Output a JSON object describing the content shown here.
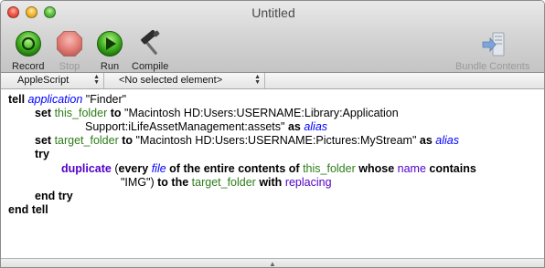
{
  "window": {
    "title": "Untitled"
  },
  "toolbar": {
    "record": "Record",
    "stop": "Stop",
    "run": "Run",
    "compile": "Compile",
    "bundle": "Bundle Contents"
  },
  "selectors": {
    "language": "AppleScript",
    "element": "<No selected element>"
  },
  "script": {
    "l1": {
      "tell": "tell",
      "application": "application",
      "finder": "\"Finder\""
    },
    "l2": {
      "set": "set",
      "var": "this_folder",
      "to": "to",
      "path": "\"Macintosh HD:Users:USERNAME:Library:Application"
    },
    "l3": {
      "path2": "Support:iLifeAssetManagement:assets\"",
      "as": "as",
      "alias": "alias"
    },
    "l4": {
      "set": "set",
      "var": "target_folder",
      "to": "to",
      "path": "\"Macintosh HD:Users:USERNAME:Pictures:MyStream\"",
      "as": "as",
      "alias": "alias"
    },
    "l5": {
      "try": "try"
    },
    "l6": {
      "duplicate": "duplicate",
      "open": "(",
      "every": "every",
      "file": "file",
      "of": "of the",
      "entire": "entire contents",
      "of2": "of",
      "var": "this_folder",
      "whose": "whose",
      "name": "name",
      "contains": "contains"
    },
    "l7": {
      "img": "\"IMG\")",
      "to": "to the",
      "var": "target_folder",
      "with": "with",
      "replacing": "replacing"
    },
    "l8": {
      "endtry": "end try"
    },
    "l9": {
      "endtell": "end tell"
    }
  },
  "icons": {
    "record": "record-icon",
    "stop": "stop-icon",
    "run": "run-icon",
    "compile": "hammer-icon",
    "bundle": "bundle-contents-icon"
  }
}
